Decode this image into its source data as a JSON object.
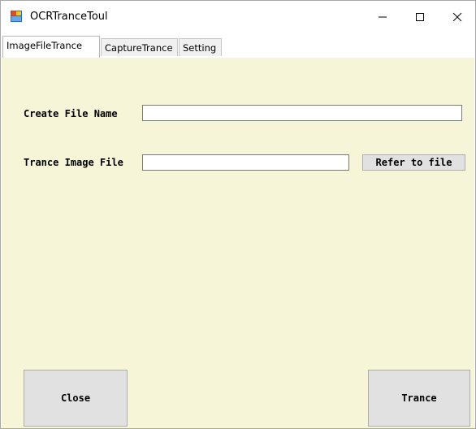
{
  "window": {
    "title": "OCRTranceToul",
    "controls": {
      "minimize": "—",
      "maximize": "☐",
      "close": "✕"
    }
  },
  "tabs": [
    {
      "label": "ImageFileTrance",
      "active": true
    },
    {
      "label": "CaptureTrance",
      "active": false
    },
    {
      "label": "Setting",
      "active": false
    }
  ],
  "annotation": {
    "color": "#e32020",
    "target": "Setting"
  },
  "form": {
    "create_file_name_label": "Create File Name",
    "create_file_name_value": "",
    "trance_image_file_label": "Trance Image File",
    "trance_image_file_value": "",
    "refer_button": "Refer to file"
  },
  "buttons": {
    "close": "Close",
    "trance": "Trance"
  },
  "colors": {
    "panel_bg": "#f6f5d7",
    "button_bg": "#e1e1e1"
  }
}
